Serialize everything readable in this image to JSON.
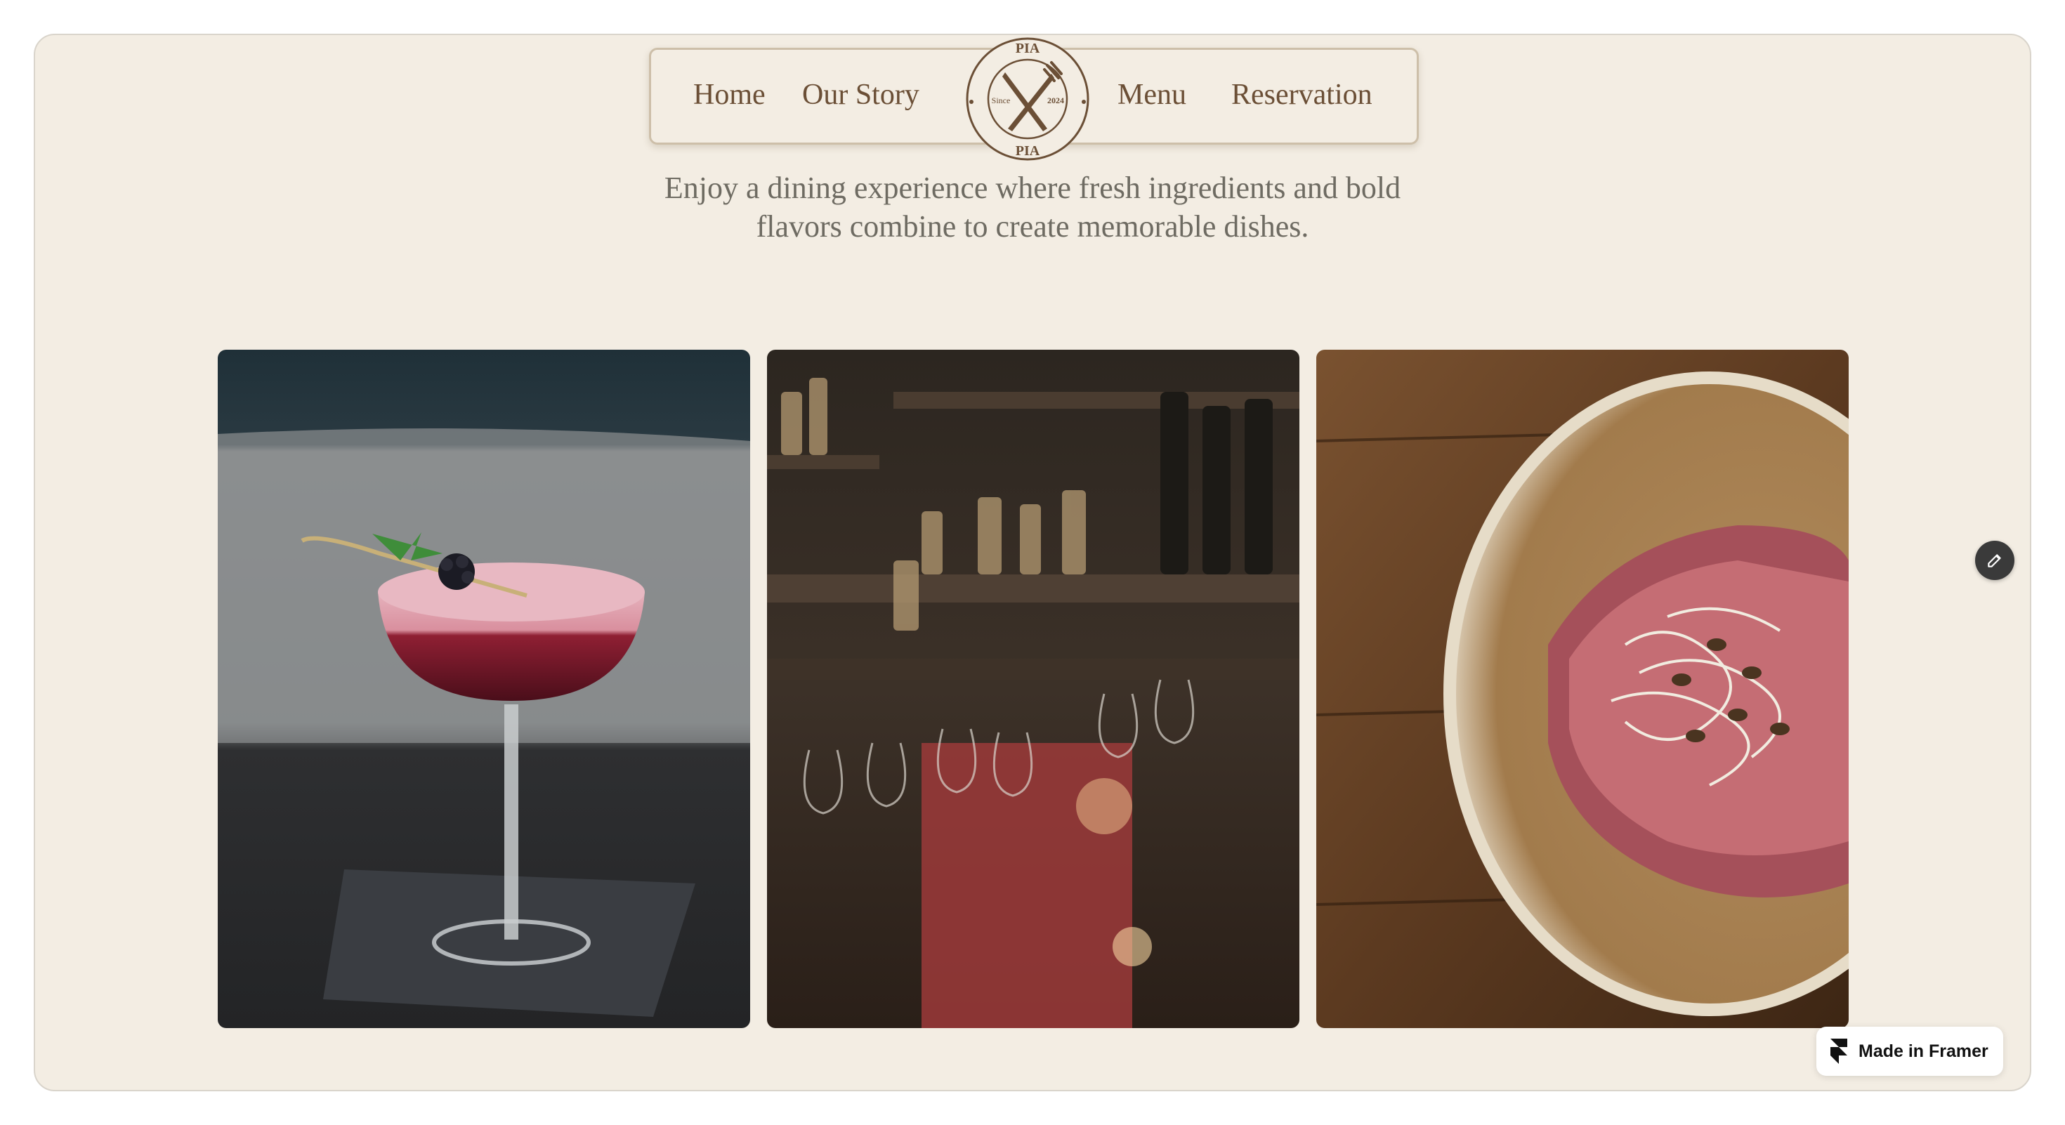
{
  "nav": {
    "links": [
      {
        "label": "Home"
      },
      {
        "label": "Our Story"
      },
      {
        "label": "Menu"
      },
      {
        "label": "Reservation"
      }
    ],
    "logo": {
      "top_text": "PIA",
      "bottom_text": "PIA",
      "left_text": "Since",
      "right_text": "2024",
      "icon": "fork-knife-icon"
    }
  },
  "hero": {
    "tagline_line1": "Enjoy a dining experience where fresh ingredients and bold",
    "tagline_line2": "flavors combine to create memorable dishes."
  },
  "gallery": [
    {
      "subject": "cocktail"
    },
    {
      "subject": "bar"
    },
    {
      "subject": "dish"
    }
  ],
  "badge": {
    "label": "Made in Framer",
    "icon": "framer-icon"
  },
  "edit": {
    "icon": "pencil-icon"
  },
  "colors": {
    "background": "#f3ede3",
    "nav_text": "#6b4f36",
    "tagline": "#6e6b62",
    "logo": "#6b4f36"
  }
}
